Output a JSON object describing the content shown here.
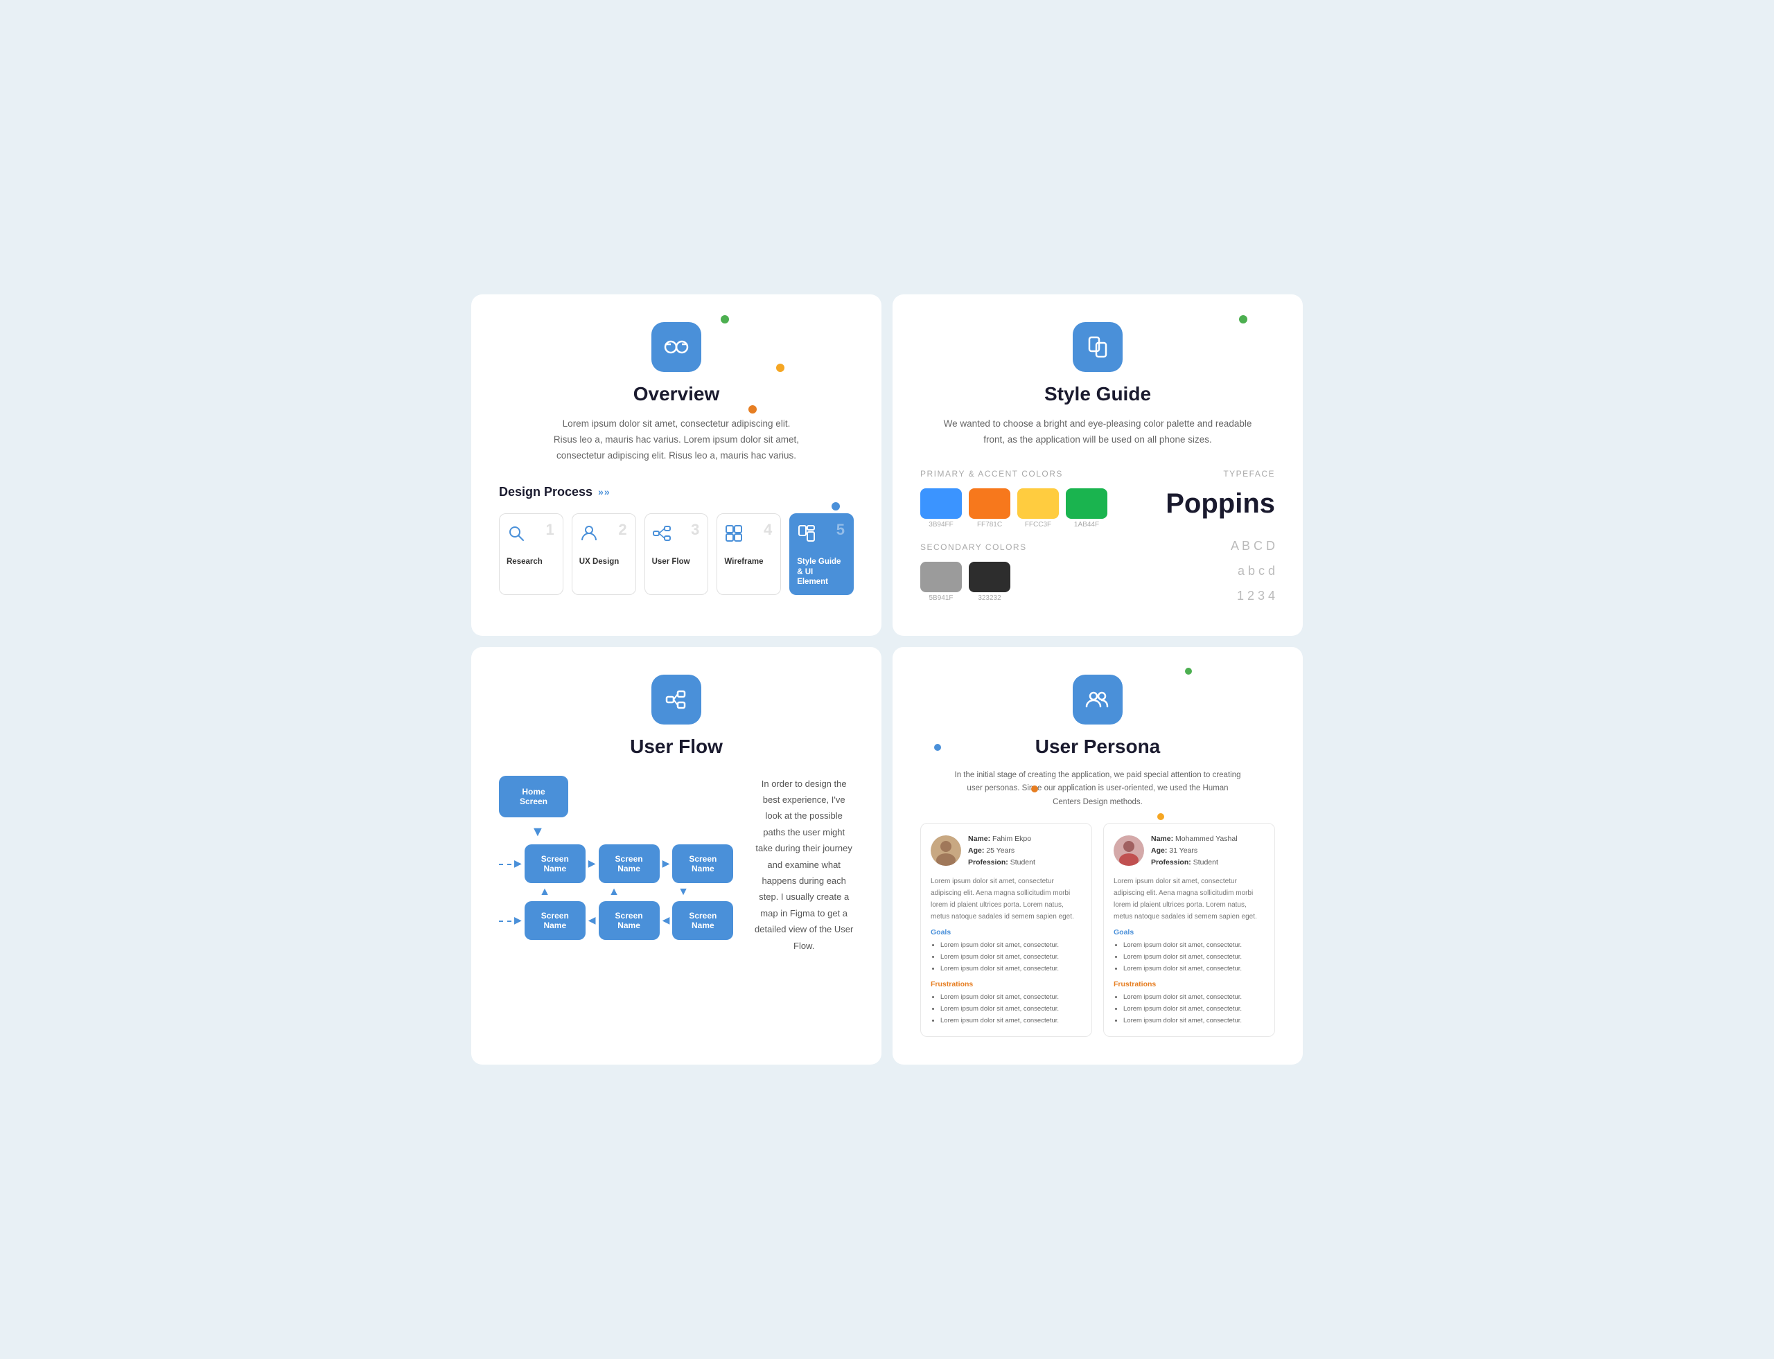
{
  "overview": {
    "title": "Overview",
    "description": "Lorem ipsum dolor sit amet, consectetur adipiscing elit. Risus leo a, mauris hac varius. Lorem ipsum dolor sit amet, consectetur adipiscing elit. Risus leo a, mauris hac varius.",
    "design_process_label": "Design Process",
    "steps": [
      {
        "id": 1,
        "label": "Research",
        "icon": "search",
        "active": false
      },
      {
        "id": 2,
        "label": "UX Design",
        "icon": "user",
        "active": false
      },
      {
        "id": 3,
        "label": "User Flow",
        "icon": "flow",
        "active": false
      },
      {
        "id": 4,
        "label": "Wireframe",
        "icon": "grid",
        "active": false
      },
      {
        "id": 5,
        "label": "Style Guide & UI Element",
        "icon": "style",
        "active": true
      }
    ]
  },
  "style_guide": {
    "title": "Style Guide",
    "description": "We wanted to choose a bright and eye-pleasing color palette and readable front, as the application will be used on all phone sizes.",
    "primary_label": "Primary & accent colors",
    "typeface_label": "Typeface",
    "colors": [
      {
        "hex": "#3B94FF",
        "code": "3B94FF"
      },
      {
        "hex": "#F7781C",
        "code": "FF781C"
      },
      {
        "hex": "#FFCC3F",
        "code": "FFCC3F"
      },
      {
        "hex": "#1AB44F",
        "code": "1AB44F"
      }
    ],
    "secondary_label": "Secondary colors",
    "secondary_colors": [
      {
        "hex": "#9B9B9B",
        "code": "5B941F"
      },
      {
        "hex": "#2D2D2D",
        "code": "323232"
      }
    ],
    "typeface_name": "Poppins",
    "typeface_upper": "A B C D",
    "typeface_lower": "a b c d",
    "typeface_nums": "1 2 3 4"
  },
  "user_flow": {
    "title": "User Flow",
    "description": "In order to design the best experience, I've look at the possible paths the user might take during their journey and examine  what happens during each step. I usually create a map in Figma to get a detailed view of the User Flow.",
    "home_screen": "Home\nScreen",
    "screen_name": "Screen\nName",
    "boxes_row1": [
      "Screen\nName",
      "Screen\nName",
      "Screen\nName"
    ],
    "boxes_row2": [
      "Screen\nName",
      "Screen\nName",
      "Screen\nName"
    ]
  },
  "user_persona": {
    "title": "User Persona",
    "description": "In the initial stage of creating the application, we paid special attention to creating user personas. Since our application is user-oriented, we used the Human Centers Design methods.",
    "personas": [
      {
        "name": "Fahim Ekpo",
        "age": "25 Years",
        "profession": "Student",
        "body": "Lorem ipsum dolor sit amet, consectetur adipiscing elit. Aena magna sollicitudim morbi lorem id plaient ultrices porta. Lorem natus, metus natoque sadales id semem sapien eget.",
        "goals": [
          "Lorem ipsum dolor sit amet, consectetur.",
          "Lorem ipsum dolor sit amet, consectetur.",
          "Lorem ipsum dolor sit amet, consectetur."
        ],
        "frustrations": [
          "Lorem ipsum dolor sit amet, consectetur.",
          "Lorem ipsum dolor sit amet, consectetur.",
          "Lorem ipsum dolor sit amet, consectetur."
        ]
      },
      {
        "name": "Mohammed Yashal",
        "age": "31 Years",
        "profession": "Student",
        "body": "Lorem ipsum dolor sit amet, consectetur adipiscing elit. Aena magna sollicitudim morbi lorem id plaient ultrices porta. Lorem natus, metus natoque sadales id semem sapien eget.",
        "goals": [
          "Lorem ipsum dolor sit amet, consectetur.",
          "Lorem ipsum dolor sit amet, consectetur.",
          "Lorem ipsum dolor sit amet, consectetur."
        ],
        "frustrations": [
          "Lorem ipsum dolor sit amet, consectetur.",
          "Lorem ipsum dolor sit amet, consectetur.",
          "Lorem ipsum dolor sit amet, consectetur."
        ]
      }
    ]
  }
}
